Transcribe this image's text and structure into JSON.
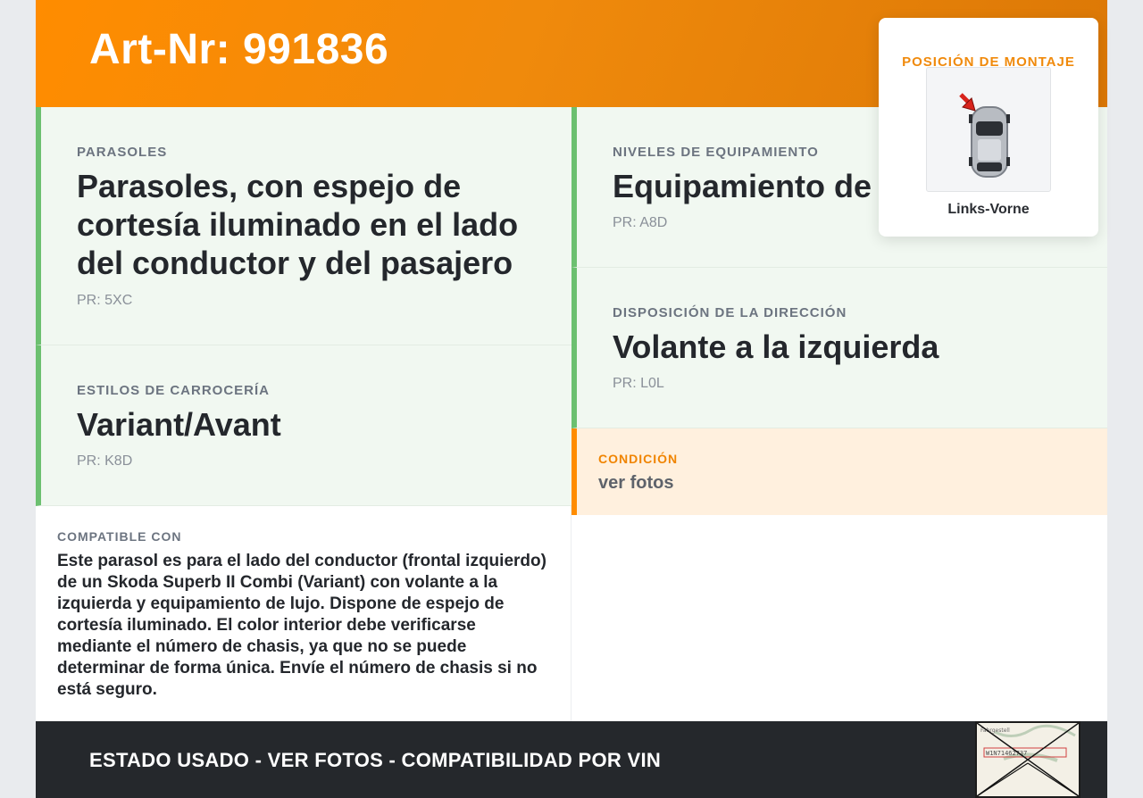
{
  "header": {
    "title": "Art-Nr: 991836"
  },
  "cards": [
    {
      "label": "PARASOLES",
      "value": "Parasoles, con espejo de cortesía iluminado en el lado del conductor y del pasajero",
      "pr": "PR: 5XC"
    },
    {
      "label": "ESTILOS DE CARROCERÍA",
      "value": "Variant/Avant",
      "pr": "PR: K8D"
    },
    {
      "label": "NIVELES DE EQUIPAMIENTO",
      "value": "Equipamiento de",
      "pr": "PR: A8D"
    },
    {
      "label": "DISPOSICIÓN DE LA DIRECCIÓN",
      "value": "Volante a la izquierda",
      "pr": "PR: L0L"
    }
  ],
  "condition": {
    "label": "CONDICIÓN",
    "value": "ver fotos"
  },
  "compatible": {
    "label": "COMPATIBLE CON",
    "text": "Este parasol es para el lado del conductor (frontal izquierdo) de un Skoda Superb II Combi (Variant) con volante a la izquierda y equipamiento de lujo. Dispone de espejo de cortesía iluminado. El color interior debe verificarse mediante el número de chasis, ya que no se puede determinar de forma única. Envíe el número de chasis si no está seguro."
  },
  "mount": {
    "title": "POSICIÓN DE MONTAJE",
    "position": "Links-Vorne"
  },
  "footer": {
    "text": "ESTADO USADO - VER FOTOS - COMPATIBILIDAD POR VIN",
    "vin_image": {
      "header": "Fahrgestell",
      "vin": "W1N71462737"
    }
  },
  "colors": {
    "accent": "#ff8c00",
    "green_border": "#6cc070",
    "card_bg": "#f1f8f1",
    "footer_bg": "#25282c"
  }
}
